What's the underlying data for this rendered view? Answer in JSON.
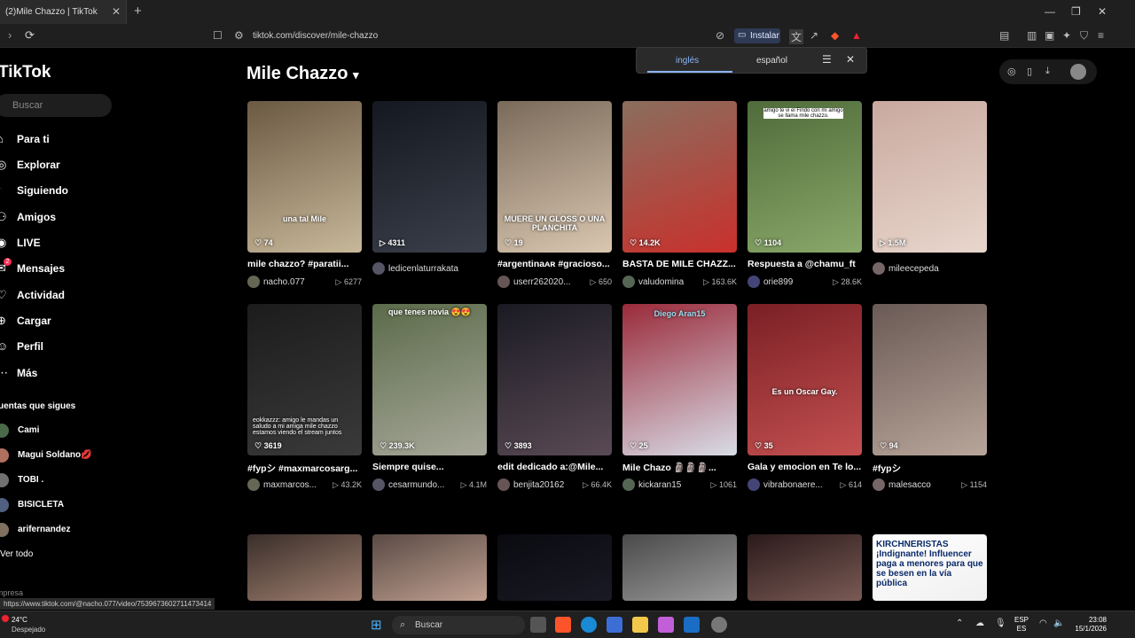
{
  "browser": {
    "tab_title": "(2)Mile Chazzo | TikTok",
    "tab_close": "✕",
    "new_tab": "+",
    "url": "tiktok.com/discover/mile-chazzo",
    "install_label": "Instalar",
    "window_controls": [
      "—",
      "❐",
      "✕"
    ]
  },
  "translate_popup": {
    "options": [
      "inglés",
      "español"
    ]
  },
  "sidebar": {
    "logo": "TikTok",
    "search_placeholder": "Buscar",
    "nav": [
      {
        "label": "Para ti",
        "icon": "home-icon"
      },
      {
        "label": "Explorar",
        "icon": "compass-icon"
      },
      {
        "label": "Siguiendo",
        "icon": "following-icon"
      },
      {
        "label": "Amigos",
        "icon": "friends-icon"
      },
      {
        "label": "LIVE",
        "icon": "live-icon"
      },
      {
        "label": "Mensajes",
        "icon": "messages-icon",
        "badge": "2"
      },
      {
        "label": "Actividad",
        "icon": "activity-icon"
      },
      {
        "label": "Cargar",
        "icon": "upload-icon"
      },
      {
        "label": "Perfil",
        "icon": "profile-icon"
      },
      {
        "label": "Más",
        "icon": "more-icon"
      }
    ],
    "following_title": "uentas que sigues",
    "following": [
      "Cami",
      "Magui Soldano💋",
      "TOBI .",
      "BISICLETA",
      "arifernandez"
    ],
    "see_all": "Ver todo",
    "company": "mpresa"
  },
  "main": {
    "title": "Mile Chazzo",
    "videos": [
      {
        "overlay": "una tal Mile",
        "stat_icon": "heart",
        "stat": "74",
        "desc": "mile chazzo? #paratii...",
        "author": "nacho.077",
        "views": "6277",
        "colors": [
          "#6b5a43",
          "#c8b89a"
        ]
      },
      {
        "overlay": "",
        "stat_icon": "play",
        "stat": "4311",
        "desc": "",
        "author": "ledicenlaturrakata",
        "views": "",
        "colors": [
          "#141820",
          "#3a3f4a"
        ]
      },
      {
        "overlay": "MUERE UN GLOSS O UNA PLANCHITA",
        "stat_icon": "heart",
        "stat": "19",
        "desc": "#argentinaᴀʀ #gracioso...",
        "author": "userr262020...",
        "views": "650",
        "colors": [
          "#7a6a5a",
          "#d9c7b0"
        ]
      },
      {
        "overlay": "",
        "stat_icon": "heart",
        "stat": "14.2K",
        "desc": "BASTA DE MILE CHAZZ...",
        "author": "valudomina",
        "views": "163.6K",
        "colors": [
          "#8a6e5e",
          "#c9302c"
        ]
      },
      {
        "overlay": "amigo te vi el Findo con mi amigo se llama mile chazzo.",
        "stat_icon": "heart",
        "stat": "1104",
        "desc": "Respuesta a @chamu_ft",
        "author": "orie899",
        "views": "28.6K",
        "colors": [
          "#4f6b3a",
          "#8aa86a"
        ]
      },
      {
        "overlay": "",
        "stat_icon": "play",
        "stat": "1.5M",
        "desc": "",
        "author": "mileecepeda",
        "views": "",
        "colors": [
          "#c9a9a0",
          "#e8d6cc"
        ]
      },
      {
        "overlay": "eokkazzz: amigo le mandas un saludo a mi amiga mile chazzo estamos viendo el stream juntos",
        "stat_icon": "heart",
        "stat": "3619",
        "desc": "#fypシ #maxmarcosarg...",
        "author": "maxmarcos...",
        "views": "43.2K",
        "colors": [
          "#1c1c1c",
          "#3a3a3a"
        ]
      },
      {
        "overlay": "que tenes novia 😍😍",
        "stat_icon": "heart",
        "stat": "239.3K",
        "desc": "Siempre quise...",
        "author": "cesarmundo...",
        "views": "4.1M",
        "colors": [
          "#5b6b4a",
          "#a8a89a"
        ]
      },
      {
        "overlay": "",
        "stat_icon": "heart",
        "stat": "3893",
        "desc": "edit dedicado a:@Mile...",
        "author": "benjita20162",
        "views": "66.4K",
        "colors": [
          "#1a1a22",
          "#5a4a55"
        ]
      },
      {
        "overlay": "Diego Aran15",
        "stat_icon": "heart",
        "stat": "25",
        "desc": "Mile Chazo 🗿🗿🗿...",
        "author": "kickaran15",
        "views": "1061",
        "colors": [
          "#9a2a3a",
          "#d8dce6"
        ]
      },
      {
        "overlay": "Es un Oscar Gay.",
        "stat_icon": "heart",
        "stat": "35",
        "desc": "Gala y emocion en Te lo...",
        "author": "vibrabonaere...",
        "views": "614",
        "colors": [
          "#7a1f25",
          "#c45050"
        ]
      },
      {
        "overlay": "",
        "stat_icon": "heart",
        "stat": "94",
        "desc": "#fypシ",
        "author": "malesacco",
        "views": "1154",
        "colors": [
          "#6a5a55",
          "#b8a59a"
        ]
      },
      {
        "overlay": "",
        "stat_icon": "",
        "stat": "",
        "desc": "",
        "author": "",
        "views": "",
        "colors": [
          "#3a2e2a",
          "#a08070"
        ]
      },
      {
        "overlay": "",
        "stat_icon": "",
        "stat": "",
        "desc": "",
        "author": "",
        "views": "",
        "colors": [
          "#5a4a45",
          "#c0a090"
        ]
      },
      {
        "overlay": "",
        "stat_icon": "",
        "stat": "",
        "desc": "",
        "author": "",
        "views": "",
        "colors": [
          "#0a0a10",
          "#1a1a25"
        ]
      },
      {
        "overlay": "",
        "stat_icon": "",
        "stat": "",
        "desc": "",
        "author": "",
        "views": "",
        "colors": [
          "#4a4a4a",
          "#9a9a9a"
        ]
      },
      {
        "overlay": "",
        "stat_icon": "",
        "stat": "",
        "desc": "",
        "author": "",
        "views": "",
        "colors": [
          "#2a1a1a",
          "#7a5a55"
        ]
      },
      {
        "overlay": "KIRCHNERISTAS ¡Indignante! Influencer paga a menores para que se besen en la vía pública",
        "stat_icon": "",
        "stat": "",
        "desc": "",
        "author": "",
        "views": "",
        "colors": [
          "#ffffff",
          "#f0f0f0"
        ]
      }
    ]
  },
  "status_url": "https://www.tiktok.com/@nacho.077/video/7539673602711473414",
  "taskbar": {
    "weather_temp": "24°C",
    "weather_desc": "Despejado",
    "search_label": "Buscar",
    "lang": [
      "ESP",
      "ES"
    ],
    "time": "23:08",
    "date": "15/1/2026"
  }
}
